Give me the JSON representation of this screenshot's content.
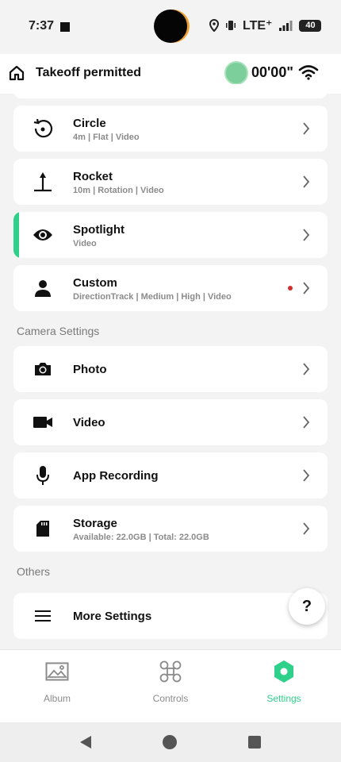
{
  "status_bar": {
    "time": "7:37",
    "network": "LTE⁺",
    "battery": "40"
  },
  "topbar": {
    "title": "Takeoff permitted",
    "timer": "00'00\""
  },
  "modes": [
    {
      "title": "Circle",
      "subtitle": "4m | Flat | Video",
      "icon": "rotate-icon"
    },
    {
      "title": "Rocket",
      "subtitle": "10m | Rotation | Video",
      "icon": "rocket-arrow-icon"
    },
    {
      "title": "Spotlight",
      "subtitle": "Video",
      "icon": "eye-icon",
      "active": true
    },
    {
      "title": "Custom",
      "subtitle": "DirectionTrack | Medium | High | Video",
      "icon": "person-icon",
      "badge": true
    }
  ],
  "camera_settings": {
    "heading": "Camera Settings",
    "items": [
      {
        "title": "Photo",
        "icon": "camera-icon"
      },
      {
        "title": "Video",
        "icon": "videocam-icon"
      },
      {
        "title": "App Recording",
        "icon": "microphone-icon"
      },
      {
        "title": "Storage",
        "subtitle": "Available: 22.0GB | Total: 22.0GB",
        "icon": "sd-card-icon"
      }
    ]
  },
  "others": {
    "heading": "Others",
    "items": [
      {
        "title": "More Settings",
        "icon": "menu-icon"
      }
    ]
  },
  "help": {
    "label": "?"
  },
  "bottom_nav": [
    {
      "label": "Album",
      "icon": "album-icon"
    },
    {
      "label": "Controls",
      "icon": "drone-icon"
    },
    {
      "label": "Settings",
      "icon": "settings-hex-icon",
      "active": true
    }
  ],
  "colors": {
    "accent": "#2fd08a",
    "badge": "#d32f2f",
    "background": "#f3f3f3"
  }
}
